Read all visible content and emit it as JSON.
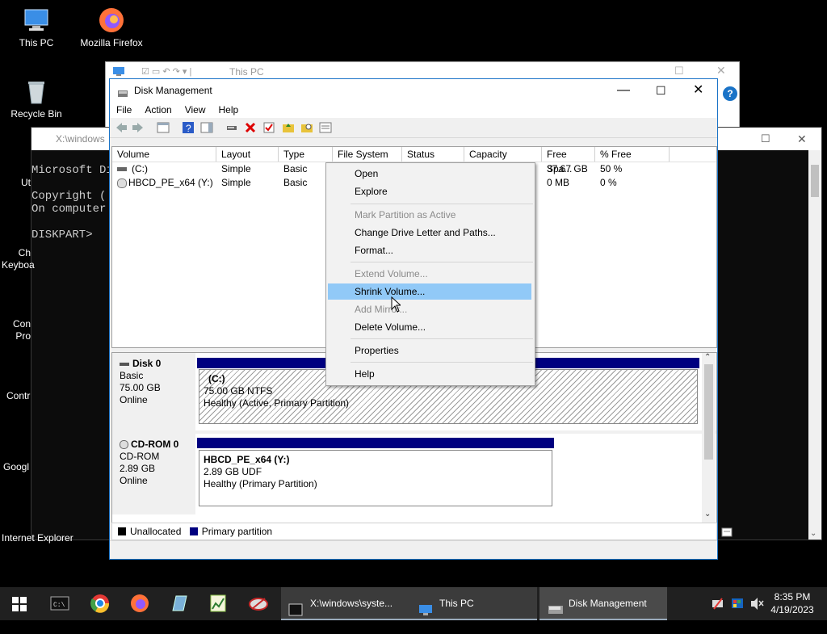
{
  "desktop": {
    "icons": [
      {
        "label": "This PC"
      },
      {
        "label": "Mozilla Firefox"
      },
      {
        "label": "Recycle Bin"
      },
      {
        "label": "Ut"
      },
      {
        "label": "Ch Keyboa"
      },
      {
        "label": "Con Pro"
      },
      {
        "label": "Contr"
      },
      {
        "label": "Googl"
      },
      {
        "label": "Internet Explorer"
      }
    ]
  },
  "console": {
    "title": "X:\\windows",
    "lines": [
      "Microsoft Di",
      "Copyright (",
      "On computer",
      "DISKPART>"
    ]
  },
  "thispc": {
    "title": "This PC"
  },
  "dm": {
    "title": "Disk Management",
    "menu": [
      "File",
      "Action",
      "View",
      "Help"
    ],
    "columns": [
      "Volume",
      "Layout",
      "Type",
      "File System",
      "Status",
      "Capacity",
      "Free Spa...",
      "% Free"
    ],
    "volumes": [
      {
        "volume": "(C:)",
        "layout": "Simple",
        "type": "Basic",
        "free": "37.67 GB",
        "pct": "50 %"
      },
      {
        "volume": "HBCD_PE_x64 (Y:)",
        "layout": "Simple",
        "type": "Basic",
        "free": "0 MB",
        "pct": "0 %"
      }
    ],
    "disks": [
      {
        "name": "Disk 0",
        "kind": "Basic",
        "size": "75.00 GB",
        "state": "Online",
        "part_name": "(C:)",
        "part_size": "75.00 GB NTFS",
        "part_status": "Healthy (Active, Primary Partition)"
      },
      {
        "name": "CD-ROM 0",
        "kind": "CD-ROM",
        "size": "2.89 GB",
        "state": "Online",
        "part_name": "HBCD_PE_x64  (Y:)",
        "part_size": "2.89 GB UDF",
        "part_status": "Healthy (Primary Partition)"
      }
    ],
    "legend": {
      "unallocated": "Unallocated",
      "primary": "Primary partition"
    }
  },
  "context_menu": {
    "items": [
      {
        "label": "Open",
        "enabled": true
      },
      {
        "label": "Explore",
        "enabled": true
      },
      {
        "label": "Mark Partition as Active",
        "enabled": false
      },
      {
        "label": "Change Drive Letter and Paths...",
        "enabled": true
      },
      {
        "label": "Format...",
        "enabled": true
      },
      {
        "label": "Extend Volume...",
        "enabled": false
      },
      {
        "label": "Shrink Volume...",
        "enabled": true,
        "highlighted": true
      },
      {
        "label": "Add Mirror...",
        "enabled": false
      },
      {
        "label": "Delete Volume...",
        "enabled": true
      },
      {
        "label": "Properties",
        "enabled": true
      },
      {
        "label": "Help",
        "enabled": true
      }
    ]
  },
  "taskbar": {
    "windows": [
      {
        "label": "X:\\windows\\syste..."
      },
      {
        "label": "This PC"
      },
      {
        "label": "Disk Management"
      }
    ],
    "time": "8:35 PM",
    "date": "4/19/2023"
  },
  "colors": {
    "primary_partition": "#000080",
    "menu_highlight": "#91c9f7",
    "accent": "#0078d7"
  }
}
